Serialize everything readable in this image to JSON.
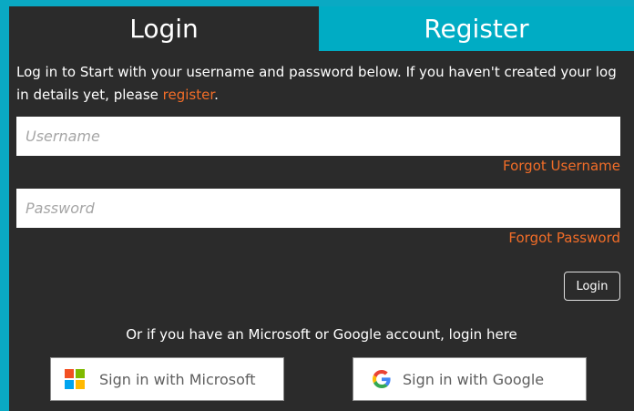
{
  "tabs": {
    "login_label": "Login",
    "register_label": "Register"
  },
  "intro": {
    "text_before": "Log in to Start with your username and password below. If you haven't created your log in details yet, please ",
    "link_text": "register",
    "text_after": "."
  },
  "form": {
    "username_placeholder": "Username",
    "password_placeholder": "Password",
    "forgot_username": "Forgot Username",
    "forgot_password": "Forgot Password",
    "login_button": "Login"
  },
  "alternative": {
    "text": "Or if you have an Microsoft or Google account, login here",
    "microsoft_label": "Sign in with Microsoft",
    "google_label": "Sign in with Google"
  },
  "colors": {
    "accent": "#00acc4",
    "link": "#f26d28",
    "panel": "#2b2b2b",
    "ms_red": "#f25022",
    "ms_green": "#7fba00",
    "ms_blue": "#00a4ef",
    "ms_yellow": "#ffb900"
  }
}
